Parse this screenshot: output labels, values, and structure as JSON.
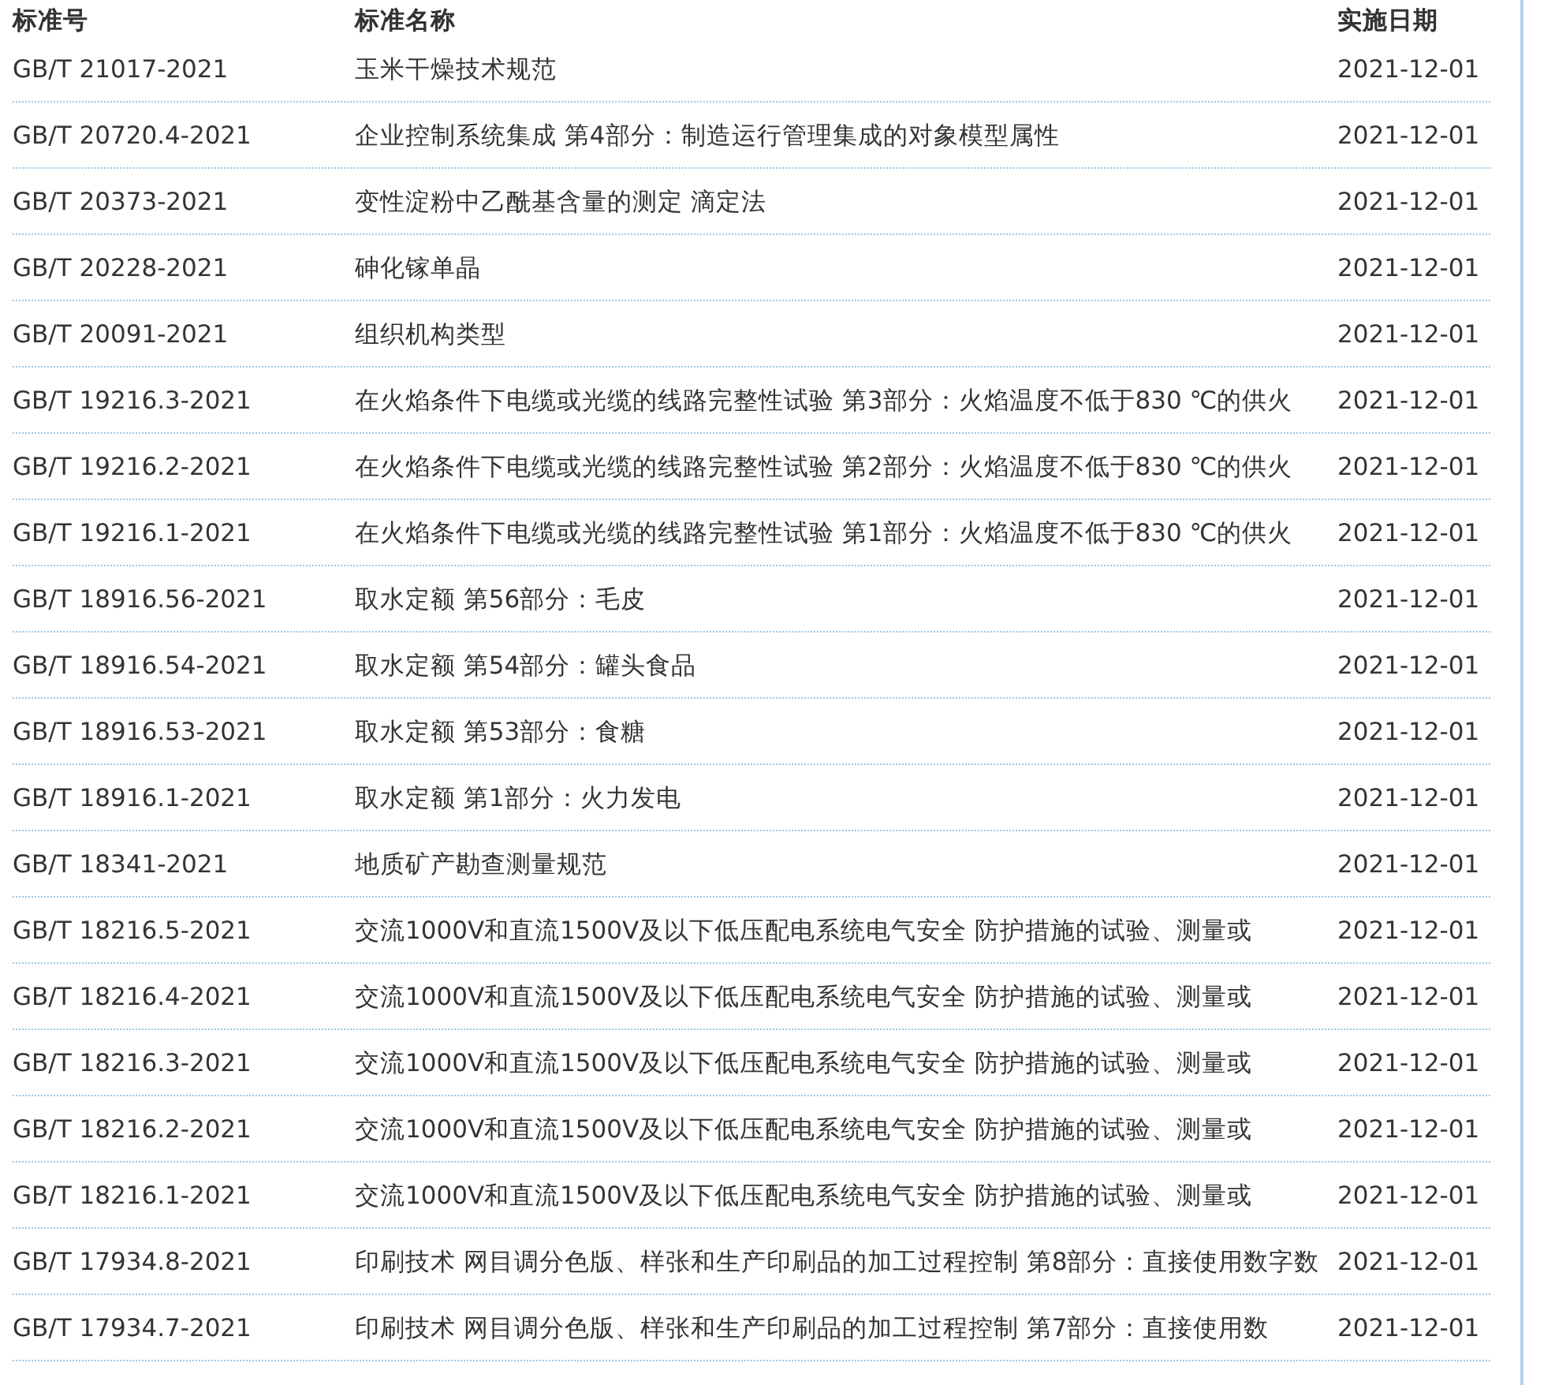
{
  "table": {
    "columns": [
      "标准号",
      "标准名称",
      "实施日期"
    ],
    "rows": [
      {
        "code": "GB/T 21017-2021",
        "name": "玉米干燥技术规范",
        "date": "2021-12-01"
      },
      {
        "code": "GB/T 20720.4-2021",
        "name": "企业控制系统集成 第4部分：制造运行管理集成的对象模型属性",
        "date": "2021-12-01"
      },
      {
        "code": "GB/T 20373-2021",
        "name": "变性淀粉中乙酰基含量的测定 滴定法",
        "date": "2021-12-01"
      },
      {
        "code": "GB/T 20228-2021",
        "name": "砷化镓单晶",
        "date": "2021-12-01"
      },
      {
        "code": "GB/T 20091-2021",
        "name": "组织机构类型",
        "date": "2021-12-01"
      },
      {
        "code": "GB/T 19216.3-2021",
        "name": "在火焰条件下电缆或光缆的线路完整性试验 第3部分：火焰温度不低于830 ℃的供火",
        "date": "2021-12-01"
      },
      {
        "code": "GB/T 19216.2-2021",
        "name": "在火焰条件下电缆或光缆的线路完整性试验 第2部分：火焰温度不低于830 ℃的供火",
        "date": "2021-12-01"
      },
      {
        "code": "GB/T 19216.1-2021",
        "name": "在火焰条件下电缆或光缆的线路完整性试验 第1部分：火焰温度不低于830 ℃的供火",
        "date": "2021-12-01"
      },
      {
        "code": "GB/T 18916.56-2021",
        "name": "取水定额 第56部分：毛皮",
        "date": "2021-12-01"
      },
      {
        "code": "GB/T 18916.54-2021",
        "name": "取水定额 第54部分：罐头食品",
        "date": "2021-12-01"
      },
      {
        "code": "GB/T 18916.53-2021",
        "name": "取水定额 第53部分：食糖",
        "date": "2021-12-01"
      },
      {
        "code": "GB/T 18916.1-2021",
        "name": "取水定额 第1部分：火力发电",
        "date": "2021-12-01"
      },
      {
        "code": "GB/T 18341-2021",
        "name": "地质矿产勘查测量规范",
        "date": "2021-12-01"
      },
      {
        "code": "GB/T 18216.5-2021",
        "name": "交流1000V和直流1500V及以下低压配电系统电气安全 防护措施的试验、测量或",
        "date": "2021-12-01"
      },
      {
        "code": "GB/T 18216.4-2021",
        "name": "交流1000V和直流1500V及以下低压配电系统电气安全 防护措施的试验、测量或",
        "date": "2021-12-01"
      },
      {
        "code": "GB/T 18216.3-2021",
        "name": "交流1000V和直流1500V及以下低压配电系统电气安全 防护措施的试验、测量或",
        "date": "2021-12-01"
      },
      {
        "code": "GB/T 18216.2-2021",
        "name": "交流1000V和直流1500V及以下低压配电系统电气安全 防护措施的试验、测量或",
        "date": "2021-12-01"
      },
      {
        "code": "GB/T 18216.1-2021",
        "name": "交流1000V和直流1500V及以下低压配电系统电气安全 防护措施的试验、测量或",
        "date": "2021-12-01"
      },
      {
        "code": "GB/T 17934.8-2021",
        "name": "印刷技术 网目调分色版、样张和生产印刷品的加工过程控制 第8部分：直接使用数字数",
        "date": "2021-12-01"
      },
      {
        "code": "GB/T 17934.7-2021",
        "name": "印刷技术 网目调分色版、样张和生产印刷品的加工过程控制 第7部分：直接使用数",
        "date": "2021-12-01"
      }
    ]
  }
}
